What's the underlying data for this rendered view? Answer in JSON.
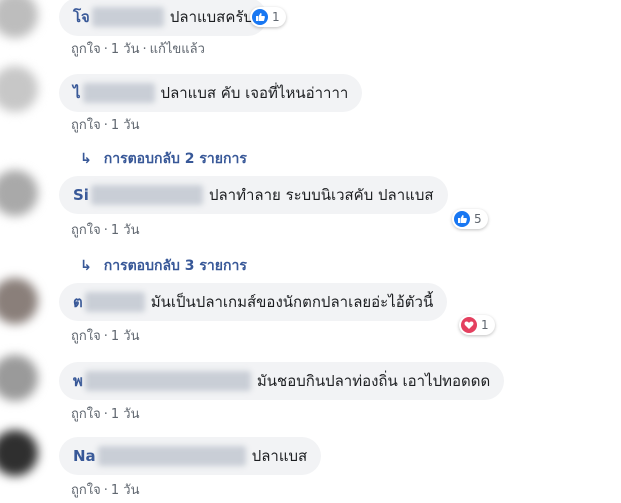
{
  "comments": [
    {
      "author_prefix": "โจ",
      "text": "ปลาแบสครับ",
      "meta": [
        "ถูกใจ",
        "·",
        "1 วัน",
        "·",
        "แก้ไขแล้ว"
      ],
      "reaction": {
        "icon": "like-icon",
        "count": "1",
        "color": "#1877f2"
      }
    },
    {
      "author_prefix": "ไ",
      "text": "ปลาแบส คับ เจอที่ไหนอ่าาาา",
      "meta": [
        "ถูกใจ",
        "·",
        "1 วัน"
      ],
      "replies": "การตอบกลับ 2 รายการ"
    },
    {
      "author_prefix": "Si",
      "text": "ปลาทำลาย ระบบนิเวสคับ ปลาแบส",
      "meta": [
        "ถูกใจ",
        "·",
        "1 วัน"
      ],
      "reaction": {
        "icon": "like-icon",
        "count": "5",
        "color": "#1877f2"
      },
      "replies": "การตอบกลับ 3 รายการ"
    },
    {
      "author_prefix": "ต",
      "text": "มันเป็นปลาเกมส์ของนักตกปลาเลยอ่ะไอ้ตัวนี้",
      "meta": [
        "ถูกใจ",
        "·",
        "1 วัน"
      ],
      "reaction": {
        "icon": "love-icon",
        "count": "1",
        "color": "#e4405f"
      }
    },
    {
      "author_prefix": "พ",
      "text": "มันชอบกินปลาท่องถิ่น เอาไปทอดดด",
      "meta": [
        "ถูกใจ",
        "·",
        "1 วัน"
      ]
    },
    {
      "author_prefix": "Na",
      "text": "ปลาแบส",
      "meta": [
        "ถูกใจ",
        "·",
        "1 วัน"
      ]
    }
  ],
  "colors": {
    "author": "#385898",
    "bubble": "#f2f3f5",
    "meta": "#606770"
  }
}
